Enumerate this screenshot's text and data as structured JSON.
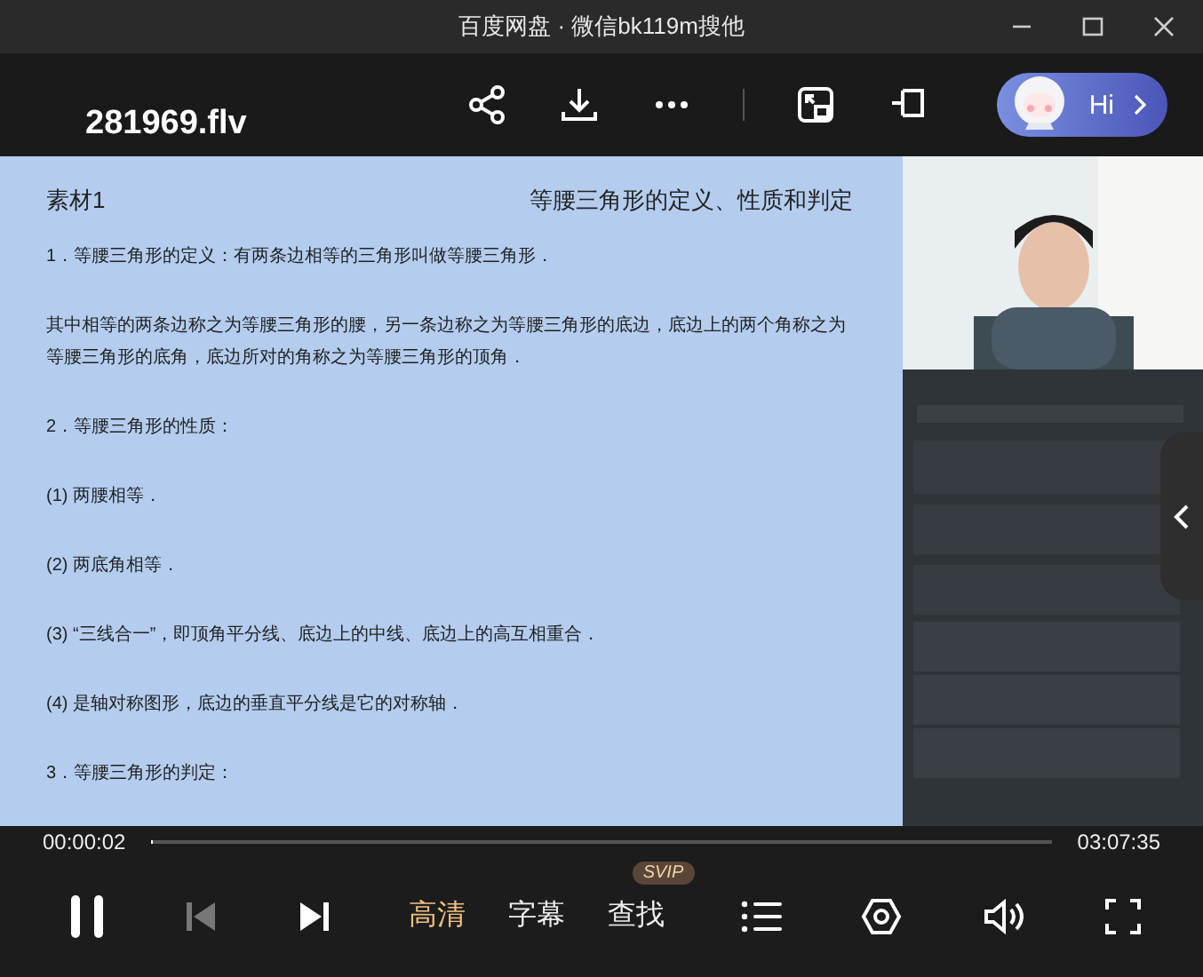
{
  "window": {
    "title": "百度网盘 · 微信bk119m搜他"
  },
  "header": {
    "filename": "281969.flv",
    "assistant_label": "Hi"
  },
  "slide": {
    "label": "素材1",
    "title": "等腰三角形的定义、性质和判定",
    "paragraphs": [
      {
        "text": "1．等腰三角形的定义：有两条边相等的三角形叫做等腰三角形．"
      },
      {
        "text": "其中相等的两条边称之为等腰三角形的腰，另一条边称之为等腰三角形的底边，底边上的两个角称之为等腰三角形的底角，底边所对的角称之为等腰三角形的顶角．"
      },
      {
        "text": "2．等腰三角形的性质："
      },
      {
        "text": "(1) 两腰相等．"
      },
      {
        "text": "(2) 两底角相等．"
      },
      {
        "text": "(3) “三线合一”，即顶角平分线、底边上的中线、底边上的高互相重合．"
      },
      {
        "text": "(4) 是轴对称图形，底边的垂直平分线是它的对称轴．"
      },
      {
        "text": "3．等腰三角形的判定："
      }
    ]
  },
  "player": {
    "current_time": "00:00:02",
    "total_time": "03:07:35",
    "level": 0.0002,
    "prev_disabled": true,
    "options": [
      {
        "label": "高清",
        "selected": true
      },
      {
        "label": "字幕",
        "selected": false
      },
      {
        "label": "查找",
        "selected": false,
        "badge": "SVIP"
      }
    ]
  }
}
